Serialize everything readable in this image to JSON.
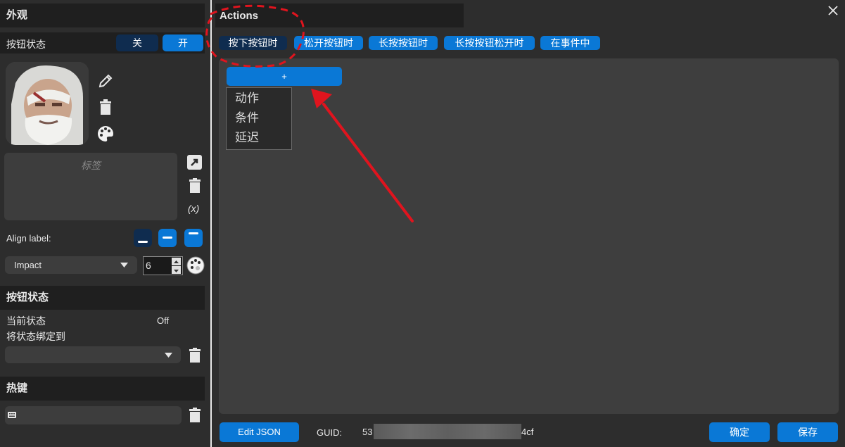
{
  "left": {
    "appearance_title": "外观",
    "button_state_label": "按钮状态",
    "toggle_off": "关",
    "toggle_on": "开",
    "label_placeholder": "标签",
    "var_icon_text": "(x)",
    "align_label": "Align label:",
    "font_name": "Impact",
    "font_size": "6",
    "state_section_title": "按钮状态",
    "current_state_label": "当前状态",
    "current_state_value": "Off",
    "bind_state_label": "将状态绑定到",
    "bind_state_value": "",
    "hotkey_title": "热键",
    "hotkey_value": ""
  },
  "right": {
    "title": "Actions",
    "tabs": [
      {
        "label": "按下按钮时",
        "active": true
      },
      {
        "label": "松开按钮时",
        "active": false
      },
      {
        "label": "长按按钮时",
        "active": false
      },
      {
        "label": "长按按钮松开时",
        "active": false
      },
      {
        "label": "在事件中",
        "active": false
      }
    ],
    "add_button": "+",
    "menu": [
      "动作",
      "条件",
      "延迟"
    ],
    "edit_json": "Edit JSON",
    "guid_label": "GUID:",
    "guid_prefix": "53",
    "guid_suffix": "4cf",
    "confirm": "确定",
    "save": "保存"
  },
  "colors": {
    "accent": "#0a78d6",
    "active_tab": "#0f2c4f",
    "annotation": "#e0141e"
  },
  "icons": [
    "close-icon",
    "pencil-icon",
    "trash-icon",
    "palette-icon",
    "open-external-icon",
    "variable-icon",
    "align-bottom-icon",
    "align-middle-icon",
    "align-top-icon",
    "chevron-down-icon",
    "spin-up-icon",
    "spin-down-icon",
    "keyboard-icon"
  ]
}
